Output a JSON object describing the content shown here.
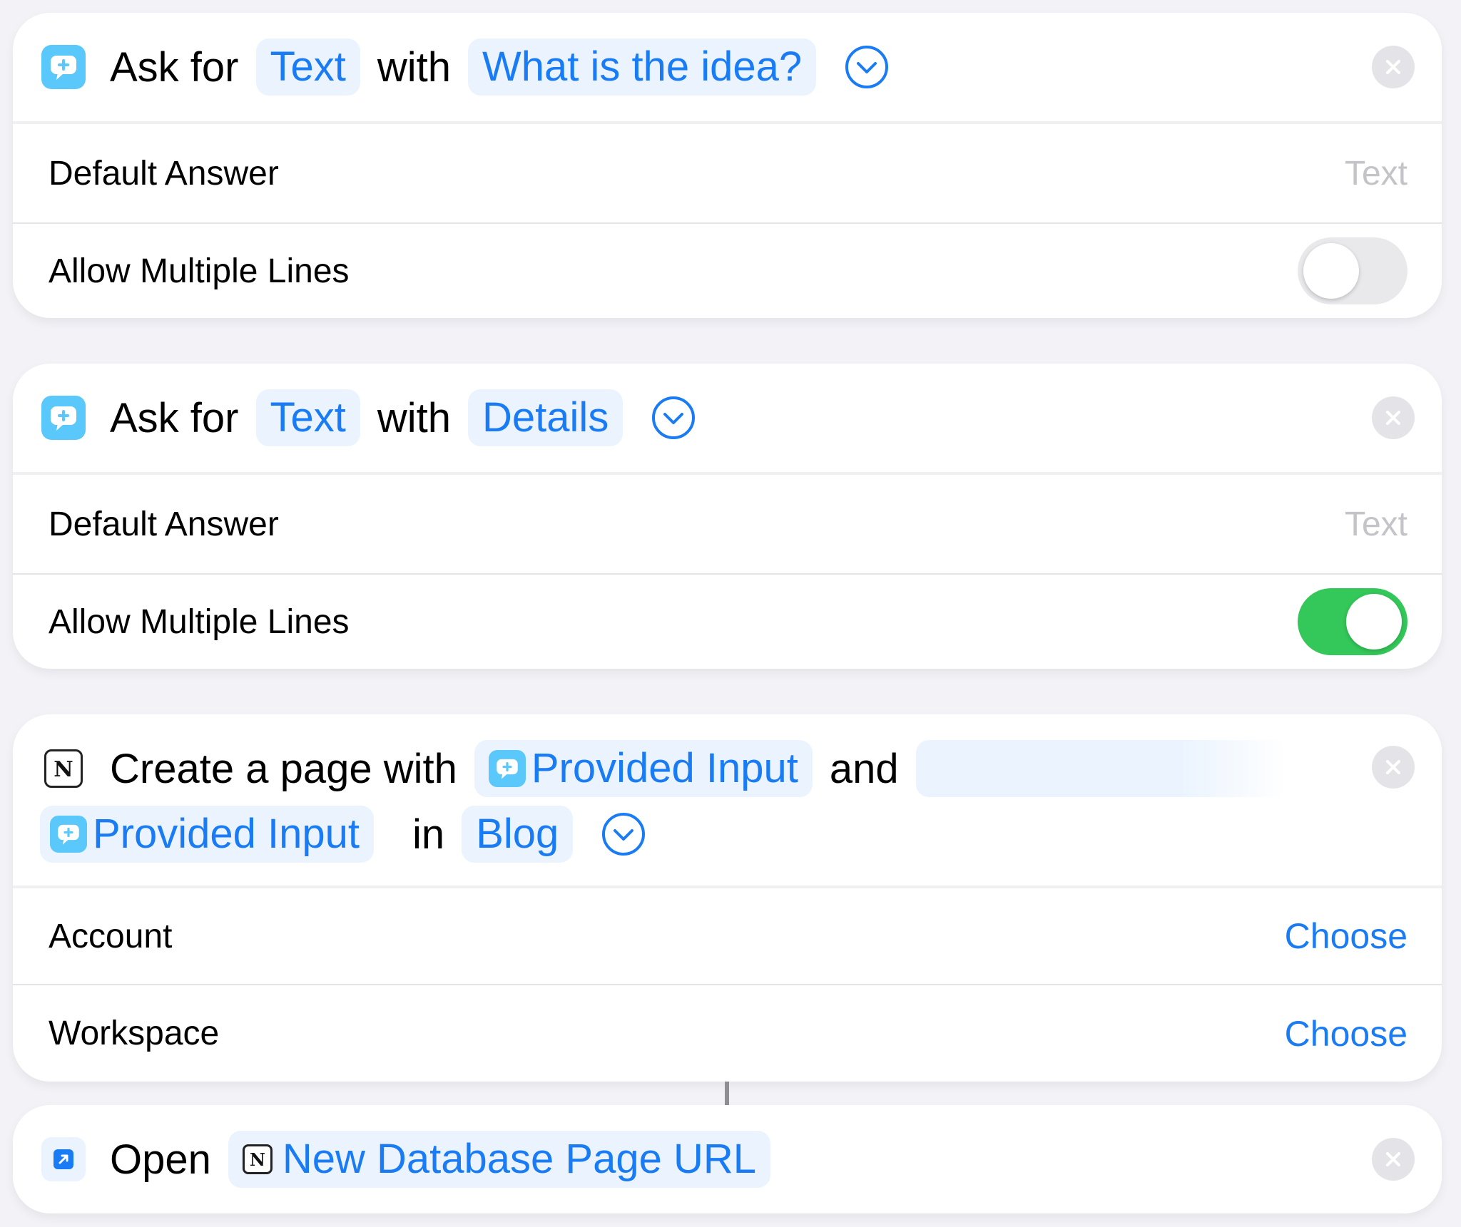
{
  "colors": {
    "accent": "#1a7cf5",
    "token_bg": "#eaf3fe",
    "toggle_on": "#34c759",
    "toggle_off": "#e9e9ec",
    "placeholder": "#c4c4c8",
    "background": "#f2f2f7"
  },
  "action1": {
    "icon": "speech-bubble-plus-icon",
    "word_ask_for": "Ask for",
    "type_token": "Text",
    "word_with": "with",
    "prompt_token": "What is the idea?",
    "default_answer_label": "Default Answer",
    "default_answer_placeholder": "Text",
    "multiple_lines_label": "Allow Multiple Lines",
    "multiple_lines_enabled": false
  },
  "action2": {
    "icon": "speech-bubble-plus-icon",
    "word_ask_for": "Ask for",
    "type_token": "Text",
    "word_with": "with",
    "prompt_token": "Details",
    "default_answer_label": "Default Answer",
    "default_answer_placeholder": "Text",
    "multiple_lines_label": "Allow Multiple Lines",
    "multiple_lines_enabled": true
  },
  "action3": {
    "icon": "notion-icon",
    "word_create": "Create a page with",
    "input_token_1": "Provided Input",
    "word_and": "and",
    "input_token_2": "Provided Input",
    "word_in": "in",
    "database_token": "Blog",
    "account_label": "Account",
    "account_value": "Choose",
    "workspace_label": "Workspace",
    "workspace_value": "Choose"
  },
  "action4": {
    "icon": "open-url-icon",
    "word_open": "Open",
    "url_token": "New Database Page URL"
  }
}
